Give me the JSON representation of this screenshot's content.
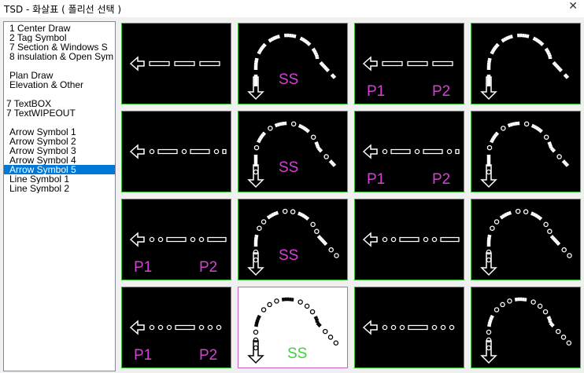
{
  "window": {
    "title": "TSD - 화살표 ( 폴리선 선택 )",
    "close_glyph": "✕"
  },
  "list": {
    "items": [
      {
        "label": "1 Center Draw"
      },
      {
        "label": "2 Tag Symbol"
      },
      {
        "label": "7 Section & Windows S"
      },
      {
        "label": "8 insulation & Open Sym"
      },
      {
        "label": ""
      },
      {
        "label": "Plan Draw"
      },
      {
        "label": "Elevation & Other"
      },
      {
        "label": ""
      },
      {
        "label": "7 TextBOX"
      },
      {
        "label": "7 TextWIPEOUT"
      },
      {
        "label": ""
      },
      {
        "label": "Arrow Symbol 1"
      },
      {
        "label": "Arrow Symbol 2"
      },
      {
        "label": "Arrow Symbol 3"
      },
      {
        "label": "Arrow Symbol 4"
      },
      {
        "label": "Arrow Symbol 5"
      },
      {
        "label": "Line Symbol 1"
      },
      {
        "label": "Line Symbol 2"
      }
    ],
    "selected_index": 15
  },
  "grid": {
    "cells": [
      {
        "type": "straight",
        "style": "dash",
        "labels": []
      },
      {
        "type": "curve",
        "style": "dash",
        "labels": [
          "SS"
        ]
      },
      {
        "type": "straight",
        "style": "dash",
        "labels": [
          "P1",
          "P2"
        ]
      },
      {
        "type": "curve",
        "style": "dash",
        "labels": []
      },
      {
        "type": "straight",
        "style": "dashdot",
        "labels": []
      },
      {
        "type": "curve",
        "style": "dashdot",
        "labels": [
          "SS"
        ]
      },
      {
        "type": "straight",
        "style": "dashdot",
        "labels": [
          "P1",
          "P2"
        ]
      },
      {
        "type": "curve",
        "style": "dashdot",
        "labels": []
      },
      {
        "type": "straight",
        "style": "dotdot",
        "labels": [
          "P1",
          "P2"
        ]
      },
      {
        "type": "curve",
        "style": "dotdot",
        "labels": [
          "SS"
        ]
      },
      {
        "type": "straight",
        "style": "dotdot",
        "labels": []
      },
      {
        "type": "curve",
        "style": "dotdot",
        "labels": []
      },
      {
        "type": "straight",
        "style": "dots",
        "labels": [
          "P1",
          "P2"
        ]
      },
      {
        "type": "curve",
        "style": "dots",
        "labels": [
          "SS"
        ],
        "selected": true
      },
      {
        "type": "straight",
        "style": "dots",
        "labels": []
      },
      {
        "type": "curve",
        "style": "dots",
        "labels": []
      }
    ]
  },
  "colors": {
    "label_magenta": "#d640d6",
    "label_green": "#3ad43a",
    "cell_border": "#2fbf2f",
    "selection": "#0078d7"
  }
}
